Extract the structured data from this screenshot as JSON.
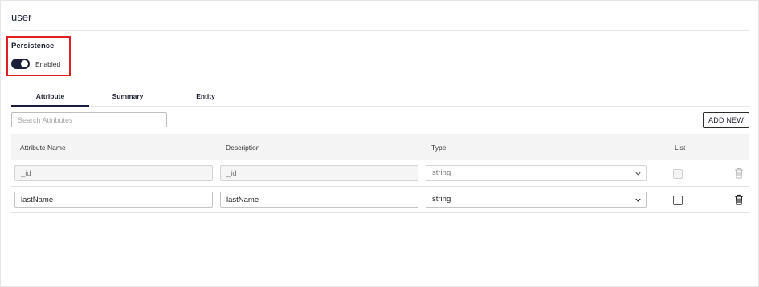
{
  "page": {
    "title": "user"
  },
  "persistence": {
    "label": "Persistence",
    "toggle_text": "Enabled",
    "enabled": true
  },
  "tabs": [
    {
      "label": "Attribute",
      "active": true
    },
    {
      "label": "Summary",
      "active": false
    },
    {
      "label": "Entity",
      "active": false
    }
  ],
  "search": {
    "placeholder": "Search Attributes",
    "value": ""
  },
  "toolbar": {
    "add_label": "ADD NEW"
  },
  "table": {
    "headers": {
      "name": "Attribute Name",
      "description": "Description",
      "type": "Type",
      "list": "List"
    },
    "rows": [
      {
        "name": "_id",
        "description": "_id",
        "type": "string",
        "list": false,
        "editable": false
      },
      {
        "name": "lastName",
        "description": "lastName",
        "type": "string",
        "list": false,
        "editable": true
      }
    ]
  },
  "colors": {
    "accent": "#1b1d3a",
    "highlight_box": "#e02020",
    "header_bg": "#f4f4f4"
  }
}
